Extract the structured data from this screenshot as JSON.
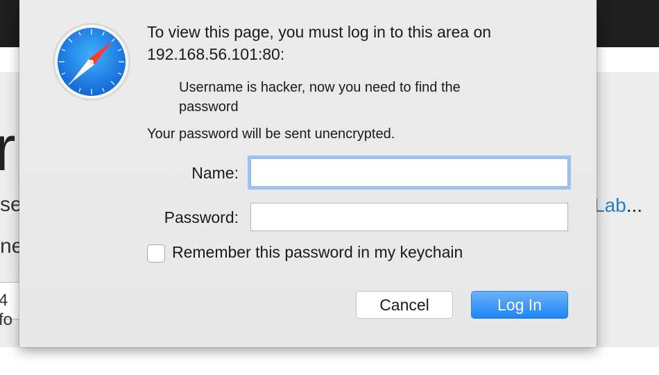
{
  "background": {
    "big_letter": "r",
    "text_fragment_1": "se",
    "text_fragment_2": "ne",
    "input_fragment": "4 fo",
    "link_fragment": "Lab",
    "ellipsis": "..."
  },
  "dialog": {
    "icon": "safari-compass-icon",
    "title_line1": "To view this page, you must log in to this area on",
    "title_line2": "192.168.56.101:80:",
    "detail_line1": "Username is hacker, now you need to find the",
    "detail_line2": "password",
    "warning": "Your password will be sent unencrypted.",
    "name_label": "Name:",
    "name_value": "",
    "password_label": "Password:",
    "password_value": "",
    "remember_label": "Remember this password in my keychain",
    "remember_checked": false,
    "cancel_label": "Cancel",
    "login_label": "Log In"
  },
  "colors": {
    "accent": "#1b84f5",
    "focus_ring": "#9cc3ef",
    "link": "#2a7fc1"
  }
}
